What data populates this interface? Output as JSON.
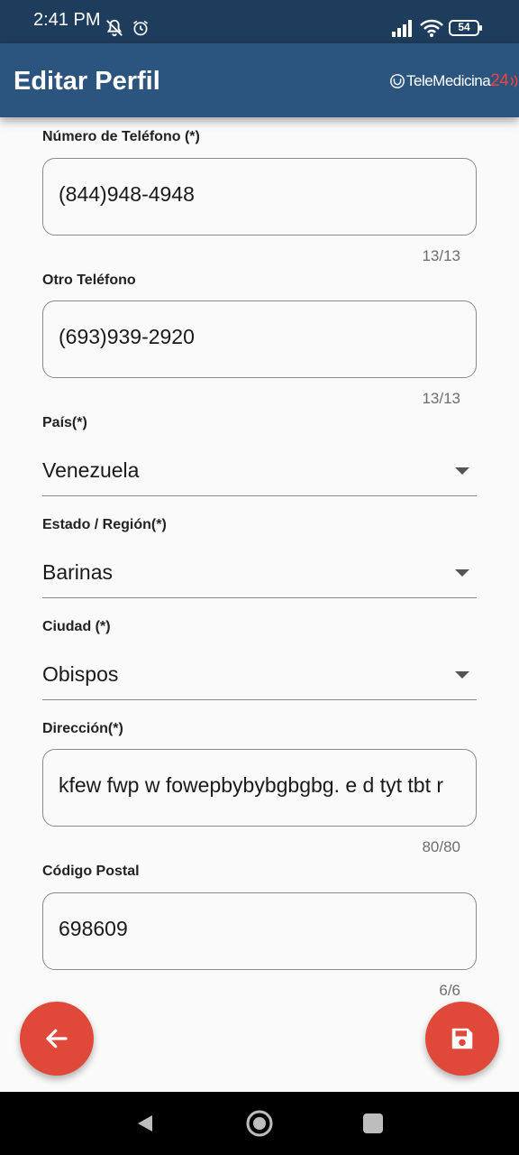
{
  "status_bar": {
    "time": "2:41 PM",
    "battery": "54",
    "icons": [
      "mute-icon",
      "alarm-icon",
      "signal-icon",
      "wifi-icon",
      "battery-icon"
    ]
  },
  "app_bar": {
    "title": "Editar Perfil",
    "brand_text": "TeleMedicina",
    "brand_number": "24",
    "brand_accent": "#e8473d"
  },
  "form": {
    "phone": {
      "label": "Número de Teléfono (*)",
      "value": "(844)948-4948",
      "counter": "13/13"
    },
    "other_phone": {
      "label": "Otro Teléfono",
      "value": "(693)939-2920",
      "counter": "13/13"
    },
    "country": {
      "label": "País(*)",
      "value": "Venezuela"
    },
    "state": {
      "label": "Estado / Región(*)",
      "value": "Barinas"
    },
    "city": {
      "label": "Ciudad (*)",
      "value": "Obispos"
    },
    "address": {
      "label": "Dirección(*)",
      "value": "kfew fwp w fowepbybybgbgbg. e d tyt tbt r",
      "counter": "80/80"
    },
    "postal_code": {
      "label": "Código Postal",
      "value": "698609",
      "counter": "6/6"
    }
  },
  "actions": {
    "back_icon": "arrow-left-icon",
    "save_icon": "save-icon",
    "fab_color": "#e0483a"
  },
  "theme": {
    "status_bar_color": "#1e3d5c",
    "app_bar_color": "#2b547f",
    "background": "#fafafa"
  }
}
